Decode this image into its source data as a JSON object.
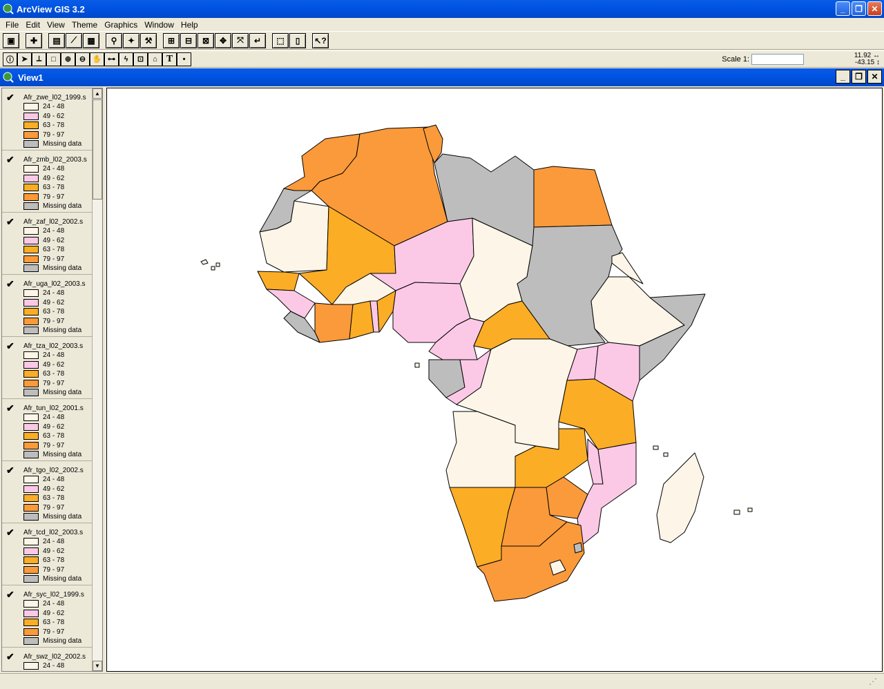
{
  "app": {
    "title": "ArcView GIS 3.2"
  },
  "menu": [
    {
      "label": "File"
    },
    {
      "label": "Edit"
    },
    {
      "label": "View"
    },
    {
      "label": "Theme"
    },
    {
      "label": "Graphics"
    },
    {
      "label": "Window"
    },
    {
      "label": "Help"
    }
  ],
  "view": {
    "title": "View1"
  },
  "scale": {
    "label": "Scale 1:",
    "value": ""
  },
  "coords": {
    "x": "11.92",
    "y": "-43.15"
  },
  "legend_classes": [
    "24 - 48",
    "49 - 62",
    "63 - 78",
    "79 - 97",
    "Missing data"
  ],
  "colors": {
    "c1": "#fcf5e8",
    "c2": "#fbc9e6",
    "c3": "#fbad25",
    "c4": "#fb9a3a",
    "missing": "#bdbdbd",
    "xp_blue": "#0054e3"
  },
  "themes": [
    {
      "name": "Afr_zwe_l02_1999.s"
    },
    {
      "name": "Afr_zmb_l02_2003.s"
    },
    {
      "name": "Afr_zaf_l02_2002.s"
    },
    {
      "name": "Afr_uga_l02_2003.s"
    },
    {
      "name": "Afr_tza_l02_2003.s"
    },
    {
      "name": "Afr_tun_l02_2001.s"
    },
    {
      "name": "Afr_tgo_l02_2002.s"
    },
    {
      "name": "Afr_tcd_l02_2003.s"
    },
    {
      "name": "Afr_syc_l02_1999.s"
    },
    {
      "name": "Afr_swz_l02_2002.s"
    }
  ]
}
